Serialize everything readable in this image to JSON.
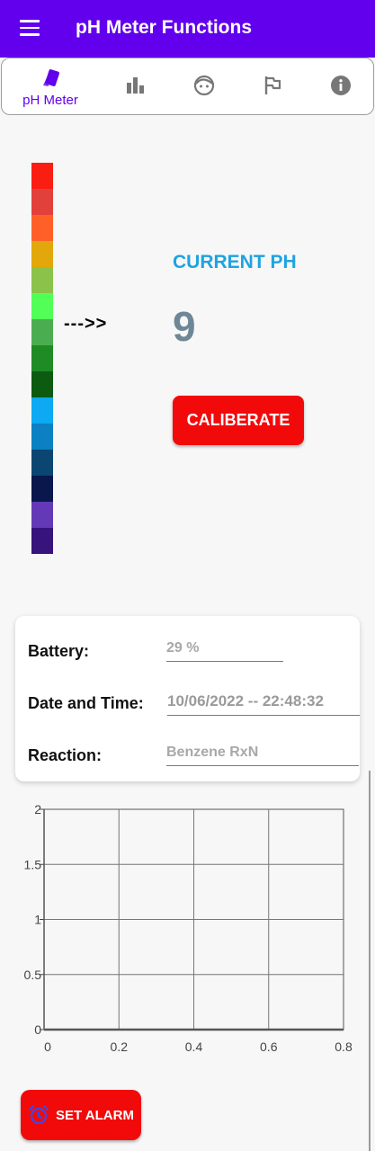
{
  "appbar": {
    "title": "pH Meter Functions",
    "menu_icon": "hamburger-menu-icon",
    "color": "#6200ee"
  },
  "navbar": {
    "items": [
      {
        "label": "pH Meter",
        "icon": "ph-tile-icon",
        "active": true
      },
      {
        "label": "",
        "icon": "bar-chart-icon"
      },
      {
        "label": "",
        "icon": "face-icon"
      },
      {
        "label": "",
        "icon": "flag-icon"
      },
      {
        "label": "",
        "icon": "info-icon"
      }
    ]
  },
  "ph_scale": {
    "colors": [
      "#fa1d12",
      "#e2403a",
      "#ff6028",
      "#e2a70b",
      "#8bc34a",
      "#52ff57",
      "#4aae50",
      "#1f8b24",
      "#0c5b11",
      "#0da9f2",
      "#0b80c2",
      "#0b4672",
      "#0a174c",
      "#6439b8",
      "#37137c"
    ]
  },
  "indicator": {
    "arrow_text": "--->>"
  },
  "current_ph": {
    "label": "CURRENT PH",
    "value": "9"
  },
  "calibrate_button": {
    "label": "CALIBERATE"
  },
  "info_card": {
    "battery": {
      "label": "Battery:",
      "value": "29 %"
    },
    "datetime": {
      "label": "Date and Time:",
      "value": "10/06/2022 -- 22:48:32"
    },
    "reaction": {
      "label": "Reaction:",
      "value": "Benzene RxN"
    }
  },
  "chart_data": {
    "type": "line",
    "title": "",
    "xlabel": "",
    "ylabel": "",
    "xlim": [
      0,
      0.8
    ],
    "ylim": [
      0,
      2
    ],
    "x_ticks": [
      "0",
      "0.2",
      "0.4",
      "0.6",
      "0.8"
    ],
    "y_ticks": [
      "0",
      "0.5",
      "1",
      "1.5",
      "2"
    ],
    "grid": true,
    "series": []
  },
  "alarm_button": {
    "label": "SET ALARM",
    "icon": "alarm-clock-icon"
  }
}
